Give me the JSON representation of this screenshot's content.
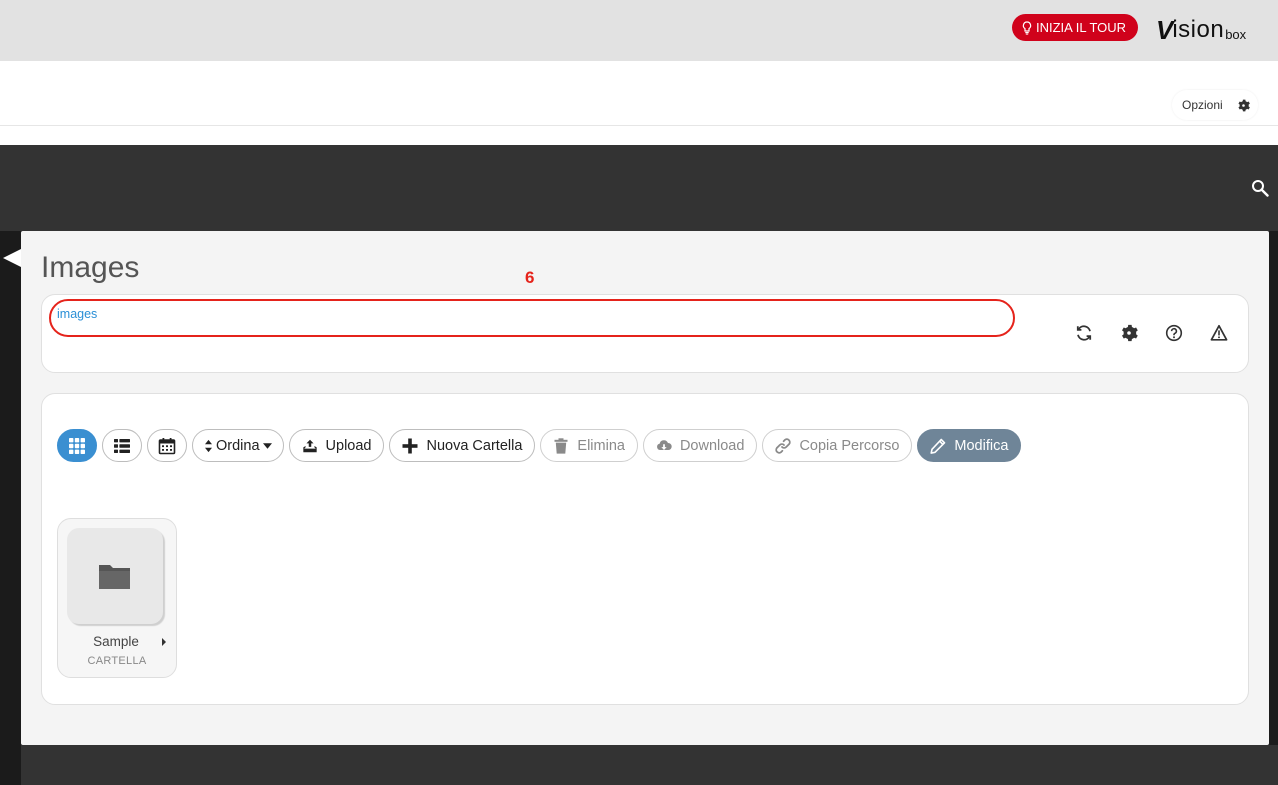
{
  "header": {
    "tour_label": "INIZIA IL TOUR",
    "logo_v": "V",
    "logo_rest": "ision",
    "logo_box": "box",
    "brand_color": "#d0021b"
  },
  "options": {
    "label": "Opzioni"
  },
  "icons": {
    "tour": "lightbulb-icon",
    "options": "gear-icon",
    "search": "search-icon",
    "refresh": "refresh-icon",
    "settings": "gear-icon",
    "help": "question-circle-icon",
    "warning": "warning-triangle-icon"
  },
  "main": {
    "title": "Images",
    "annotation_number": "6",
    "breadcrumb": "images"
  },
  "toolbar": {
    "sort_label": "Ordina",
    "upload_label": "Upload",
    "new_folder_label": "Nuova Cartella",
    "delete_label": "Elimina",
    "download_label": "Download",
    "copy_path_label": "Copia Percorso",
    "edit_label": "Modifica",
    "active_view": "grid",
    "accent_color": "#3a8fd1"
  },
  "files": [
    {
      "name": "Sample",
      "type": "CARTELLA"
    }
  ]
}
